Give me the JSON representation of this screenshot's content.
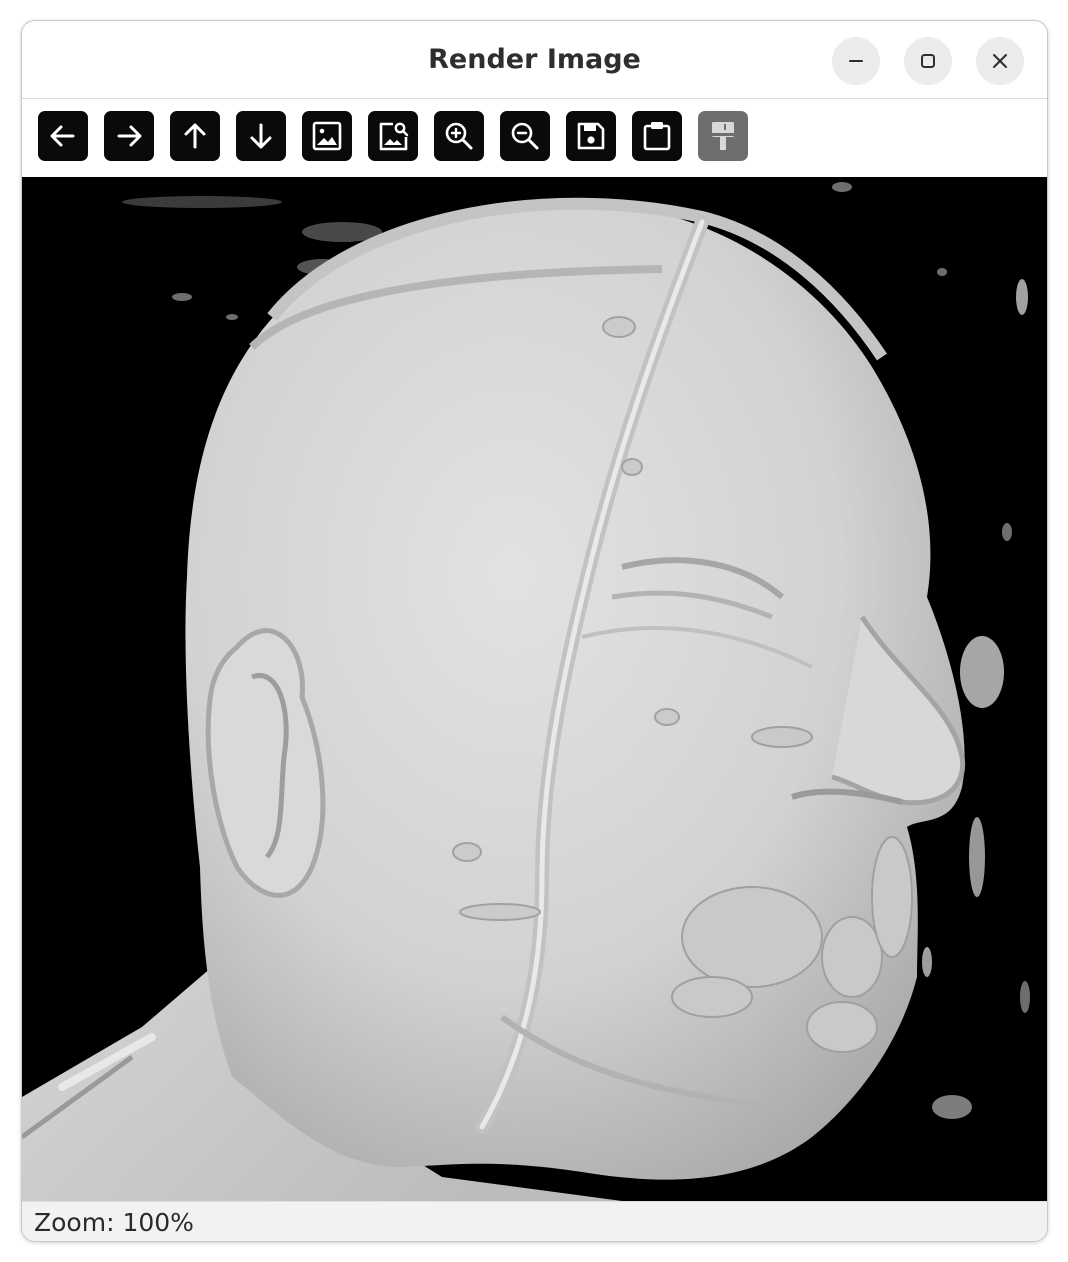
{
  "window": {
    "title": "Render Image",
    "controls": [
      "minimize",
      "maximize",
      "close"
    ]
  },
  "toolbar": {
    "buttons": [
      {
        "icon": "arrow-left-icon",
        "enabled": true
      },
      {
        "icon": "arrow-right-icon",
        "enabled": true
      },
      {
        "icon": "arrow-up-icon",
        "enabled": true
      },
      {
        "icon": "arrow-down-icon",
        "enabled": true
      },
      {
        "icon": "image-icon",
        "enabled": true
      },
      {
        "icon": "image-search-icon",
        "enabled": true
      },
      {
        "icon": "zoom-in-icon",
        "enabled": true
      },
      {
        "icon": "zoom-out-icon",
        "enabled": true
      },
      {
        "icon": "save-icon",
        "enabled": true
      },
      {
        "icon": "clipboard-icon",
        "enabled": true
      },
      {
        "icon": "paint-brush-icon",
        "enabled": false
      }
    ]
  },
  "viewport": {
    "content": "rendered-head-volume",
    "background": "#000000",
    "surface_color": "#d6d6d6"
  },
  "status": {
    "zoom_text": "Zoom: 100%"
  },
  "colors": {
    "button_bg": "#0a0a0a",
    "button_disabled_bg": "#6e6e6e",
    "status_bg": "#f2f2f2"
  }
}
